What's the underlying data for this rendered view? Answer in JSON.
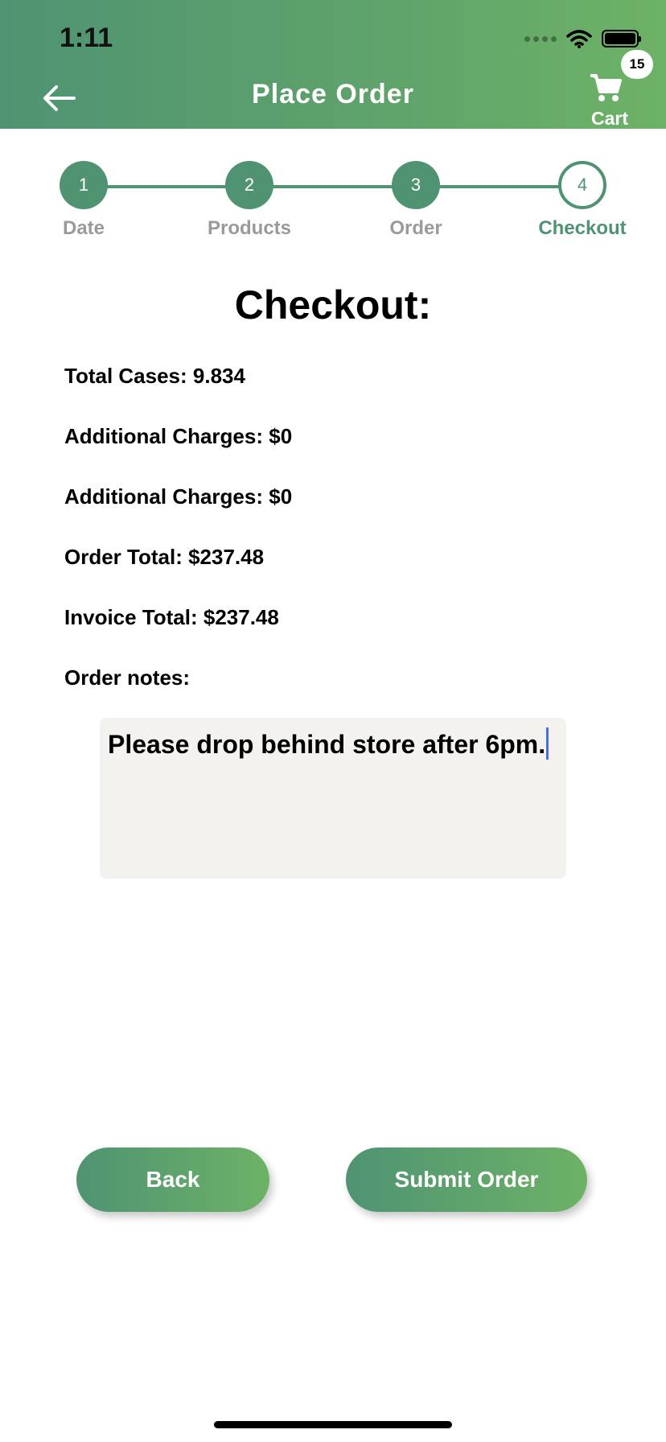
{
  "status_bar": {
    "time": "1:11"
  },
  "header": {
    "title": "Place Order",
    "cart_label": "Cart",
    "cart_count": "15"
  },
  "stepper": {
    "steps": [
      {
        "number": "1",
        "label": "Date",
        "state": "completed"
      },
      {
        "number": "2",
        "label": "Products",
        "state": "completed"
      },
      {
        "number": "3",
        "label": "Order",
        "state": "completed"
      },
      {
        "number": "4",
        "label": "Checkout",
        "state": "active"
      }
    ]
  },
  "checkout": {
    "heading": "Checkout:",
    "total_cases": "Total Cases: 9.834",
    "additional_charges_1": "Additional Charges: $0",
    "additional_charges_2": "Additional Charges: $0",
    "order_total": "Order Total: $237.48",
    "invoice_total": "Invoice Total: $237.48",
    "notes_label": "Order notes:",
    "notes_value": "Please drop behind store after 6pm."
  },
  "buttons": {
    "back": "Back",
    "submit": "Submit Order"
  },
  "colors": {
    "primary": "#4f9373",
    "primary_light": "#6db266",
    "notes_bg": "#f3f2ee",
    "inactive_label": "#9a9a9a"
  }
}
